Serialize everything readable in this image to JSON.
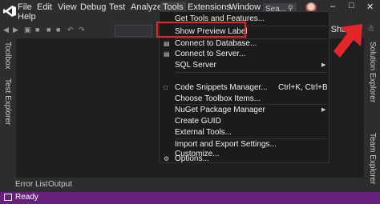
{
  "menubar": {
    "items": [
      "File",
      "Edit",
      "View",
      "Debug",
      "Test",
      "Analyze",
      "Tools",
      "Extensions",
      "Window"
    ],
    "second_row": [
      "Help"
    ],
    "search_placeholder": "Sea..."
  },
  "toolbar": {
    "live_share": "ve Share"
  },
  "side_panels": {
    "left": [
      "Toolbox",
      "Test Explorer"
    ],
    "right": [
      "Solution Explorer",
      "Team Explorer"
    ]
  },
  "bottom_tabs": [
    "Error List",
    "Output"
  ],
  "status": {
    "text": "Ready"
  },
  "tools_menu": {
    "items": [
      {
        "label": "Get Tools and Features..."
      },
      {
        "label": "Show Preview Label"
      },
      {
        "label": "Connect to Database..."
      },
      {
        "label": "Connect to Server..."
      },
      {
        "label": "SQL Server"
      },
      {
        "label": "Code Snippets Manager...",
        "shortcut": "Ctrl+K, Ctrl+B"
      },
      {
        "label": "Choose Toolbox Items..."
      },
      {
        "label": "NuGet Package Manager"
      },
      {
        "label": "Create GUID"
      },
      {
        "label": "External Tools..."
      },
      {
        "label": "Import and Export Settings..."
      },
      {
        "label": "Customize..."
      },
      {
        "label": "Options..."
      }
    ]
  },
  "colors": {
    "accent_status": "#68217a",
    "highlight": "#e3262a"
  }
}
